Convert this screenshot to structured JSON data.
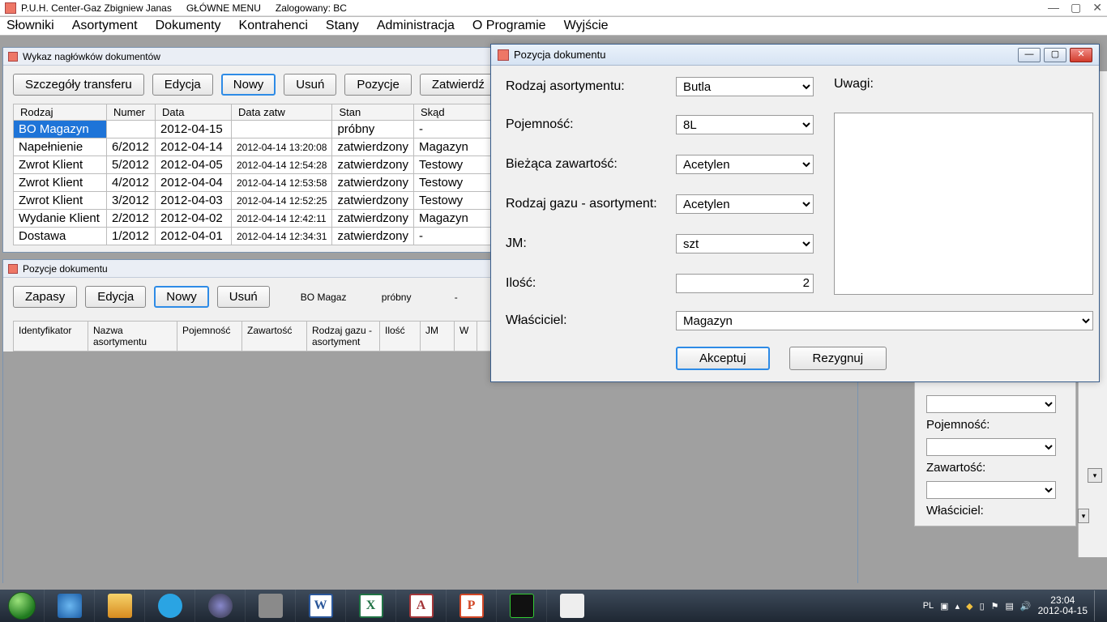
{
  "os_title": {
    "company": "P.U.H. Center-Gaz Zbigniew Janas",
    "menu_label": "GŁÓWNE MENU",
    "logged": "Zalogowany: BC"
  },
  "menu": [
    "Słowniki",
    "Asortyment",
    "Dokumenty",
    "Kontrahenci",
    "Stany",
    "Administracja",
    "O Programie",
    "Wyjście"
  ],
  "win1": {
    "title": "Wykaz nagłówków dokumentów",
    "buttons": {
      "b1": "Szczegóły transferu",
      "b2": "Edycja",
      "b3": "Nowy",
      "b4": "Usuń",
      "b5": "Pozycje",
      "b6": "Zatwierdź"
    },
    "cols": [
      "Rodzaj",
      "Numer",
      "Data",
      "Data zatw",
      "Stan",
      "Skąd"
    ],
    "rows": [
      {
        "r": "BO Magazyn",
        "n": "",
        "d": "2012-04-15",
        "dz": "",
        "s": "próbny",
        "sk": "-"
      },
      {
        "r": "Napełnienie",
        "n": "6/2012",
        "d": "2012-04-14",
        "dz": "2012-04-14 13:20:08",
        "s": "zatwierdzony",
        "sk": "Magazyn"
      },
      {
        "r": "Zwrot Klient",
        "n": "5/2012",
        "d": "2012-04-05",
        "dz": "2012-04-14 12:54:28",
        "s": "zatwierdzony",
        "sk": "Testowy"
      },
      {
        "r": "Zwrot Klient",
        "n": "4/2012",
        "d": "2012-04-04",
        "dz": "2012-04-14 12:53:58",
        "s": "zatwierdzony",
        "sk": "Testowy"
      },
      {
        "r": "Zwrot Klient",
        "n": "3/2012",
        "d": "2012-04-03",
        "dz": "2012-04-14 12:52:25",
        "s": "zatwierdzony",
        "sk": "Testowy"
      },
      {
        "r": "Wydanie Klient",
        "n": "2/2012",
        "d": "2012-04-02",
        "dz": "2012-04-14 12:42:11",
        "s": "zatwierdzony",
        "sk": "Magazyn"
      },
      {
        "r": "Dostawa",
        "n": "1/2012",
        "d": "2012-04-01",
        "dz": "2012-04-14 12:34:31",
        "s": "zatwierdzony",
        "sk": "-"
      }
    ]
  },
  "win2": {
    "title": "Pozycje dokumentu",
    "buttons": {
      "b1": "Zapasy",
      "b2": "Edycja",
      "b3": "Nowy",
      "b4": "Usuń"
    },
    "info": {
      "a": "BO Magaz",
      "b": "próbny",
      "c": "-"
    },
    "cols": [
      "Identyfikator",
      "Nazwa asortymentu",
      "Pojemność",
      "Zawartość",
      "Rodzaj gazu - asortyment",
      "Ilość",
      "JM",
      "W"
    ]
  },
  "dialog": {
    "title": "Pozycja dokumentu",
    "labels": {
      "rodzaj": "Rodzaj asortymentu:",
      "pojem": "Pojemność:",
      "biez": "Bieżąca zawartość:",
      "gaz": "Rodzaj gazu - asortyment:",
      "jm": "JM:",
      "ilosc": "Ilość:",
      "wlasc": "Właściciel:",
      "uwagi": "Uwagi:"
    },
    "values": {
      "rodzaj": "Butla",
      "pojem": "8L",
      "biez": "Acetylen",
      "gaz": "Acetylen",
      "jm": "szt",
      "ilosc": "2",
      "wlasc": "Magazyn"
    },
    "buttons": {
      "ok": "Akceptuj",
      "cancel": "Rezygnuj"
    }
  },
  "side": {
    "pojem": "Pojemność:",
    "zaw": "Zawartość:",
    "wlasc": "Właściciel:"
  },
  "tray": {
    "lang": "PL",
    "time": "23:04",
    "date": "2012-04-15"
  }
}
